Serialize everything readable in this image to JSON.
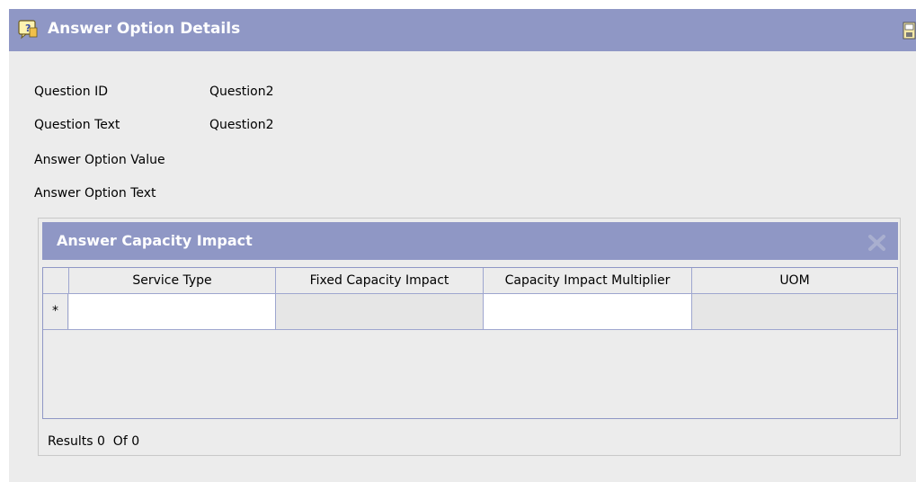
{
  "panel": {
    "title": "Answer Option Details",
    "header_icon": "question-note-icon",
    "save_icon": "save-icon"
  },
  "fields": [
    {
      "label": "Question ID",
      "value": "Question2"
    },
    {
      "label": "Question Text",
      "value": "Question2"
    },
    {
      "label": "Answer Option Value",
      "value": ""
    },
    {
      "label": "Answer Option Text",
      "value": ""
    }
  ],
  "capacity": {
    "title": "Answer Capacity Impact",
    "close_icon": "close-icon",
    "columns": [
      "Service Type",
      "Fixed Capacity Impact",
      "Capacity Impact Multiplier",
      "UOM"
    ],
    "new_row_marker": "*",
    "new_row": {
      "service_type": "",
      "fixed_capacity_impact": "",
      "capacity_impact_multiplier": "",
      "uom": ""
    },
    "results_text": "Results 0  Of 0"
  },
  "colors": {
    "header": "#8f97c5",
    "panel_bg": "#ececec",
    "grid_border": "#9ea6cf"
  }
}
